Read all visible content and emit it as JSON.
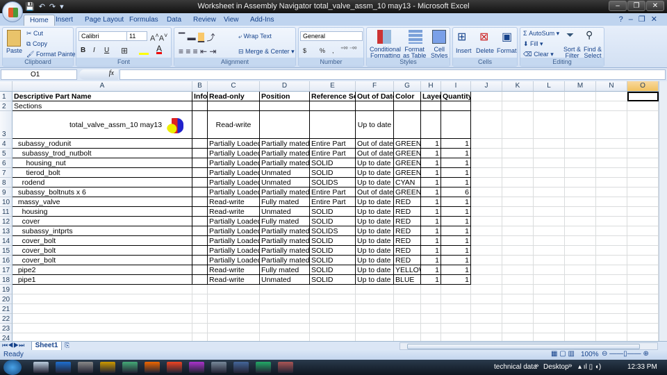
{
  "window": {
    "title": "Worksheet in Assembly Navigator total_valve_assm_10 may13 - Microsoft Excel"
  },
  "ribbon_tabs": [
    "Home",
    "Insert",
    "Page Layout",
    "Formulas",
    "Data",
    "Review",
    "View",
    "Add-Ins"
  ],
  "active_tab": "Home",
  "clipboard": {
    "paste": "Paste",
    "cut": "Cut",
    "copy": "Copy",
    "format_painter": "Format Painter",
    "label": "Clipboard"
  },
  "font": {
    "name": "Calibri",
    "size": "11",
    "bold": "B",
    "italic": "I",
    "underline": "U",
    "label": "Font"
  },
  "alignment": {
    "wrap": "Wrap Text",
    "merge": "Merge & Center",
    "label": "Alignment"
  },
  "number": {
    "format": "General",
    "currency": "$",
    "percent": "%",
    "comma": ",",
    "label": "Number"
  },
  "styles": {
    "conditional": "Conditional",
    "conditional2": "Formatting",
    "format_table": "Format",
    "format_table2": "as Table",
    "cell_styles": "Cell",
    "cell_styles2": "Styles",
    "label": "Styles"
  },
  "cells": {
    "insert": "Insert",
    "delete": "Delete",
    "format": "Format",
    "label": "Cells"
  },
  "editing": {
    "autosum": "AutoSum",
    "fill": "Fill",
    "clear": "Clear",
    "sort": "Sort &",
    "sort2": "Filter",
    "find": "Find &",
    "find2": "Select",
    "label": "Editing"
  },
  "formula_bar": {
    "name_box": "O1",
    "fx": "fx",
    "value": ""
  },
  "columns": [
    "A",
    "B",
    "C",
    "D",
    "E",
    "F",
    "G",
    "H",
    "I",
    "J",
    "K",
    "L",
    "M",
    "N",
    "O"
  ],
  "selected_column": "O",
  "headers": [
    "Descriptive Part Name",
    "Info",
    "Read-only",
    "Position",
    "Reference Set",
    "Out of Date",
    "Color",
    "Layer",
    "Quantity"
  ],
  "rows": [
    [
      "Sections",
      "",
      "",
      "",
      "",
      "",
      "",
      "",
      ""
    ],
    [
      "total_valve_assm_10 may13",
      "",
      "Read-write",
      "",
      "",
      "Up to date",
      "",
      "",
      ""
    ],
    [
      "  subassy_rodunit",
      "",
      "Partially Loaded",
      "Partially mated",
      "Entire Part",
      "Out of date",
      "GREEN",
      "1",
      "1"
    ],
    [
      "    subassy_trod_nutbolt",
      "",
      "Partially Loaded",
      "Partially mated",
      "Entire Part",
      "Out of date",
      "GREEN",
      "1",
      "1"
    ],
    [
      "      housing_nut",
      "",
      "Partially Loaded",
      "Partially mated",
      "SOLID",
      "Up to date",
      "GREEN",
      "1",
      "1"
    ],
    [
      "      tierod_bolt",
      "",
      "Partially Loaded",
      "Unmated",
      "SOLID",
      "Up to date",
      "GREEN",
      "1",
      "1"
    ],
    [
      "    rodend",
      "",
      "Partially Loaded",
      "Unmated",
      "SOLIDS",
      "Up to date",
      "CYAN",
      "1",
      "1"
    ],
    [
      "  subassy_boltnuts x 6",
      "",
      "Partially Loaded",
      "Partially mated",
      "Entire Part",
      "Out of date",
      "GREEN",
      "1",
      "6"
    ],
    [
      "  massy_valve",
      "",
      "Read-write",
      "Fully mated",
      "Entire Part",
      "Up to date",
      "RED",
      "1",
      "1"
    ],
    [
      "    housing",
      "",
      "Read-write",
      "Unmated",
      "SOLID",
      "Up to date",
      "RED",
      "1",
      "1"
    ],
    [
      "    cover",
      "",
      "Partially Loaded",
      "Fully mated",
      "SOLID",
      "Up to date",
      "RED",
      "1",
      "1"
    ],
    [
      "    subassy_intprts",
      "",
      "Partially Loaded",
      "Partially mated",
      "SOLIDS",
      "Up to date",
      "RED",
      "1",
      "1"
    ],
    [
      "    cover_bolt",
      "",
      "Partially Loaded",
      "Partially mated",
      "SOLID",
      "Up to date",
      "RED",
      "1",
      "1"
    ],
    [
      "    cover_bolt",
      "",
      "Partially Loaded",
      "Partially mated",
      "SOLID",
      "Up to date",
      "RED",
      "1",
      "1"
    ],
    [
      "    cover_bolt",
      "",
      "Partially Loaded",
      "Partially mated",
      "SOLID",
      "Up to date",
      "RED",
      "1",
      "1"
    ],
    [
      "  pipe2",
      "",
      "Read-write",
      "Fully mated",
      "SOLID",
      "Up to date",
      "YELLOW",
      "1",
      "1"
    ],
    [
      "  pipe1",
      "",
      "Read-write",
      "Unmated",
      "SOLID",
      "Up to date",
      "BLUE",
      "1",
      "1"
    ]
  ],
  "row_numbers": [
    "1",
    "2",
    "3",
    "4",
    "5",
    "6",
    "7",
    "8",
    "9",
    "10",
    "11",
    "12",
    "13",
    "14",
    "15",
    "16",
    "17",
    "18",
    "19",
    "20",
    "21",
    "22",
    "23",
    "24"
  ],
  "sheet_tabs": [
    "Sheet1"
  ],
  "status": {
    "ready": "Ready",
    "zoom": "100%"
  },
  "taskbar": {
    "toolbar1": "technical data",
    "toolbar2": "Desktop",
    "clock": "12:33 PM"
  },
  "colors": {
    "ribbon": "#dbe6f5",
    "selected_header": "#f1c15f",
    "title_bar": "#1a1a1a"
  }
}
